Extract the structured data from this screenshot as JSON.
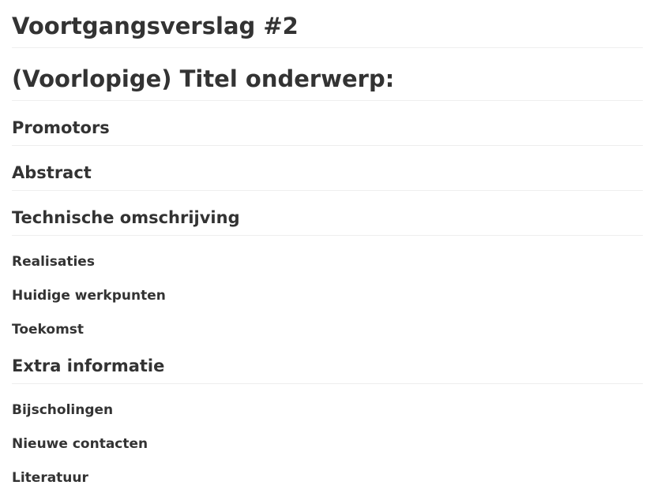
{
  "document": {
    "title": "Voortgangsverslag #2",
    "subtitle": "(Voorlopige) Titel onderwerp:",
    "sections": {
      "promotors": "Promotors",
      "abstract": "Abstract",
      "technical": "Technische omschrijving",
      "realisaties": "Realisaties",
      "werkpunten": "Huidige werkpunten",
      "toekomst": "Toekomst",
      "extra": "Extra informatie",
      "bijscholingen": "Bijscholingen",
      "contacten": "Nieuwe contacten",
      "literatuur": "Literatuur"
    }
  }
}
